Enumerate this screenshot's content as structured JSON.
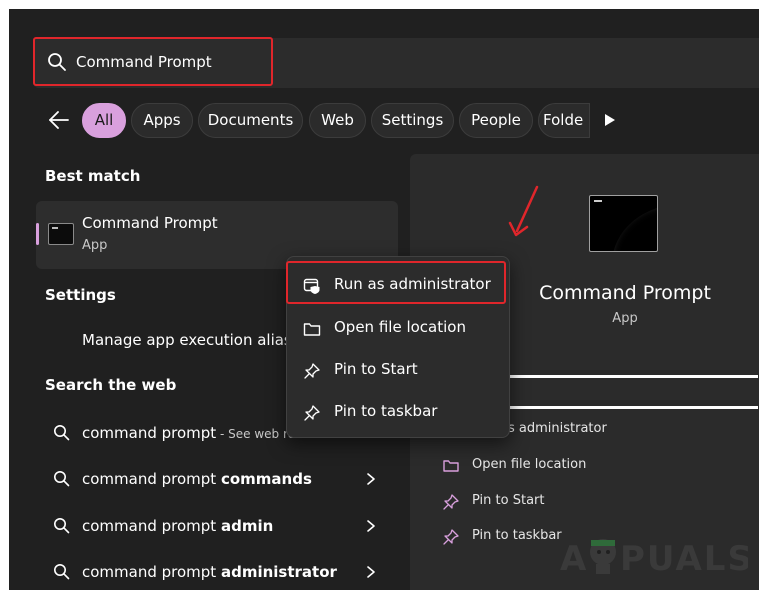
{
  "search": {
    "query": "Command Prompt"
  },
  "filters": {
    "chips": [
      "All",
      "Apps",
      "Documents",
      "Web",
      "Settings",
      "People",
      "Folde"
    ]
  },
  "best_match": {
    "heading": "Best match",
    "title": "Command Prompt",
    "subtitle": "App"
  },
  "settings": {
    "heading": "Settings",
    "item": "Manage app execution aliases"
  },
  "web": {
    "heading": "Search the web",
    "rows": [
      {
        "base": "command prompt",
        "bold": "",
        "suffix": " - See web re"
      },
      {
        "base": "command prompt ",
        "bold": "commands",
        "suffix": ""
      },
      {
        "base": "command prompt ",
        "bold": "admin",
        "suffix": ""
      },
      {
        "base": "command prompt ",
        "bold": "administrator",
        "suffix": ""
      }
    ]
  },
  "context_menu": {
    "items": [
      {
        "label": "Run as administrator",
        "icon": "shield-window-icon"
      },
      {
        "label": "Open file location",
        "icon": "folder-icon"
      },
      {
        "label": "Pin to Start",
        "icon": "pin-icon"
      },
      {
        "label": "Pin to taskbar",
        "icon": "pin-icon"
      }
    ]
  },
  "details": {
    "title": "Command Prompt",
    "subtitle": "App",
    "actions": [
      {
        "label": "s administrator",
        "icon": "shield-window-icon"
      },
      {
        "label": "Open file location",
        "icon": "folder-icon"
      },
      {
        "label": "Pin to Start",
        "icon": "pin-icon"
      },
      {
        "label": "Pin to taskbar",
        "icon": "pin-icon"
      }
    ]
  },
  "watermark": {
    "text": "A PUALS"
  },
  "colors": {
    "accent": "#d9a0dd",
    "highlight": "#e0262b",
    "background": "#202020",
    "panel": "#2b2b2b"
  }
}
